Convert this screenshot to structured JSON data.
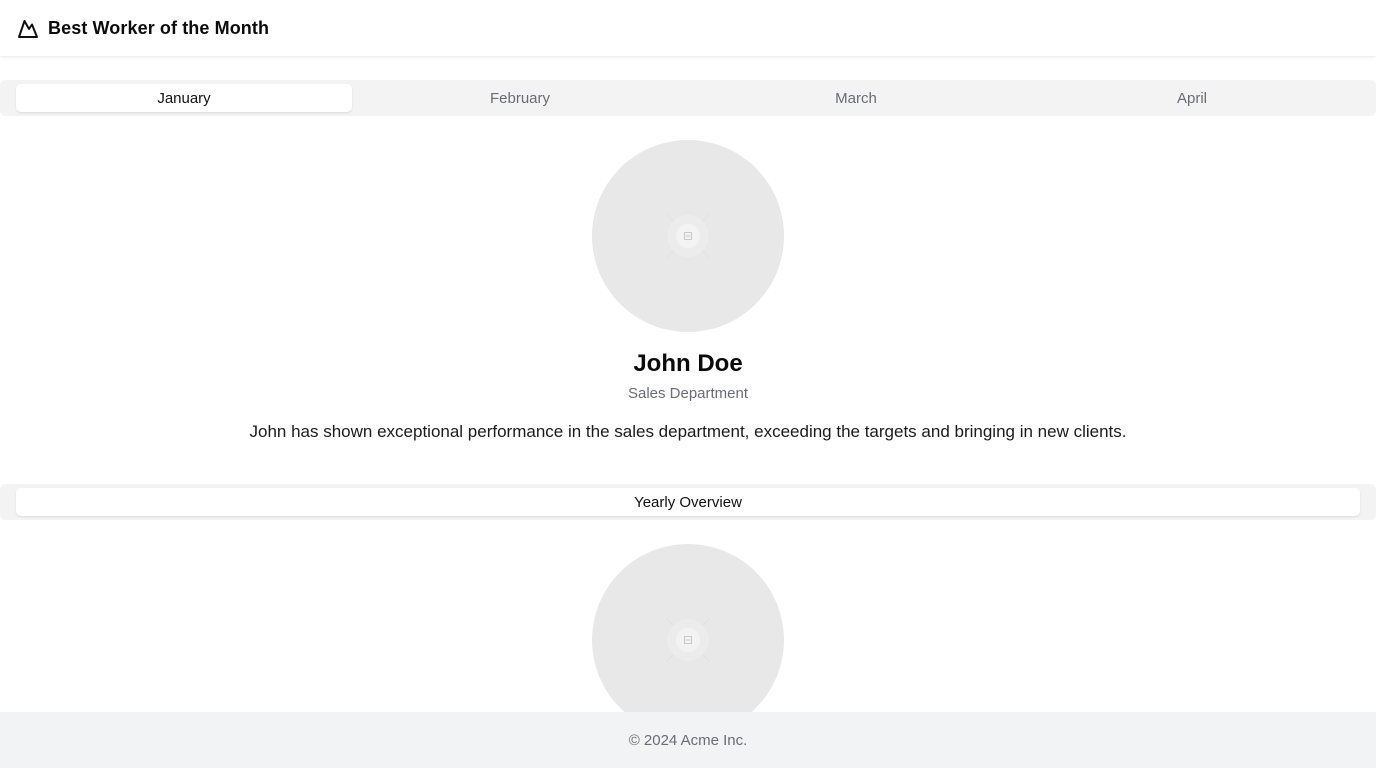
{
  "header": {
    "title": "Best Worker of the Month",
    "logo_icon": "mountain-icon"
  },
  "month_tabs": [
    {
      "label": "January",
      "active": true
    },
    {
      "label": "February",
      "active": false
    },
    {
      "label": "March",
      "active": false
    },
    {
      "label": "April",
      "active": false
    }
  ],
  "worker": {
    "avatar_icon": "image-placeholder-icon",
    "name": "John Doe",
    "department": "Sales Department",
    "description": "John has shown exceptional performance in the sales department, exceeding the targets and bringing in new clients."
  },
  "overview": {
    "tab_label": "Yearly Overview",
    "image_icon": "image-placeholder-icon"
  },
  "footer": {
    "copyright": "© 2024 Acme Inc."
  },
  "colors": {
    "header_bg": "#ffffff",
    "tabs_bg": "#f3f3f4",
    "muted_text": "#6b6b76",
    "avatar_bg": "#e8e8e8",
    "footer_bg": "#f1f3f5"
  }
}
